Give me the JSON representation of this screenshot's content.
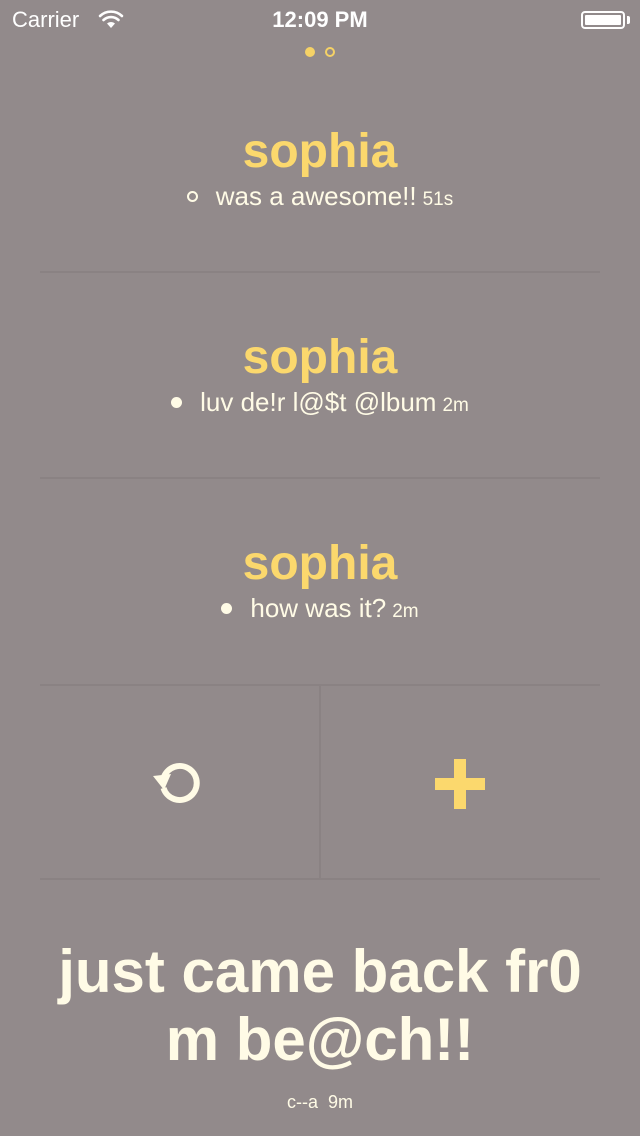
{
  "status_bar": {
    "carrier": "Carrier",
    "time": "12:09 PM",
    "battery_level": 1.0
  },
  "pager": {
    "pages": 2,
    "current": 1
  },
  "messages": [
    {
      "name": "sophia",
      "text": "was a awesome!!",
      "time": "51s",
      "read": false
    },
    {
      "name": "sophia",
      "text": "luv de!r l@$t @lbum",
      "time": "2m",
      "read": true
    },
    {
      "name": "sophia",
      "text": "how was it?",
      "time": "2m",
      "read": true
    }
  ],
  "actions": {
    "refresh_icon": "refresh-icon",
    "add_icon": "plus-icon"
  },
  "post": {
    "text": "just came back fr0 m be@ch!!",
    "line1": "just came back fr0",
    "line2": "m be@ch!!",
    "author_time": "c--a  9m"
  },
  "colors": {
    "background": "#928a8b",
    "accent": "#fbd86d",
    "text": "#fffbe6"
  }
}
